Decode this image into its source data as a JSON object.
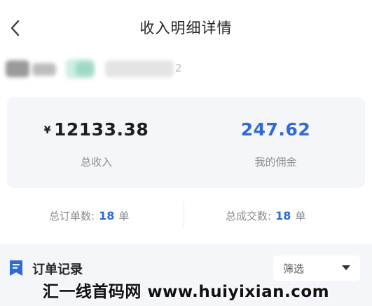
{
  "header": {
    "title": "收入明细详情"
  },
  "account": {
    "trailing_char": "2"
  },
  "summary": {
    "currency_symbol": "¥",
    "total_income": "12133.38",
    "total_income_label": "总收入",
    "commission": "247.62",
    "commission_label": "我的佣金",
    "commission_color": "#2f6ad8"
  },
  "counts": {
    "orders_label": "总订单数:",
    "orders_value": "18",
    "orders_unit": "单",
    "deals_label": "总成交数:",
    "deals_value": "18",
    "deals_unit": "单"
  },
  "records": {
    "icon": "document-icon",
    "title": "订单记录",
    "filter_label": "筛选"
  },
  "watermark": {
    "text": "汇一线首码网 www.huiyixian.com"
  }
}
